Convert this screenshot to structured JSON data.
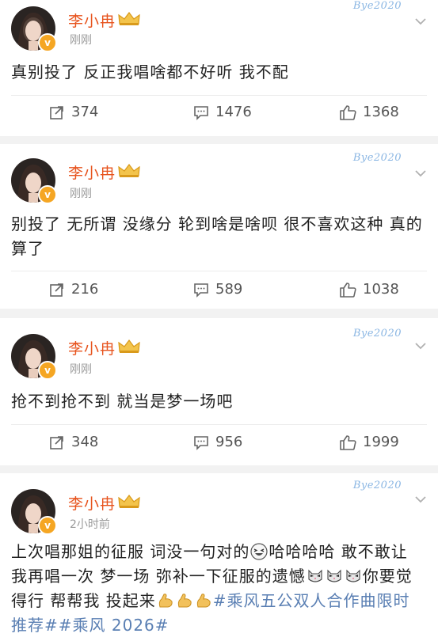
{
  "posts": [
    {
      "username": "李小冉",
      "time": "刚刚",
      "watermark": "Bye2020",
      "text": "真别投了 反正我唱啥都不好听 我不配",
      "reposts": "374",
      "comments": "1476",
      "likes": "1368"
    },
    {
      "username": "李小冉",
      "time": "刚刚",
      "watermark": "Bye2020",
      "text_line1": "别投了 无所谓 没缘分 轮到啥是啥呗 很不喜欢这种 真的",
      "text_line2": "算了",
      "reposts": "216",
      "comments": "589",
      "likes": "1038"
    },
    {
      "username": "李小冉",
      "time": "刚刚",
      "watermark": "Bye2020",
      "text": "抢不到抢不到 就当是梦一场吧",
      "reposts": "348",
      "comments": "956",
      "likes": "1999"
    },
    {
      "username": "李小冉",
      "time": "2小时前",
      "watermark": "Bye2020",
      "line1_a": "上次唱那姐的征服 词没一句对的",
      "line1_b": "哈哈哈哈 敢不敢让",
      "line2_a": "我再唱一次 梦一场 弥补一下征服的遗憾",
      "line2_b": "你要觉",
      "line3_a": "得行 帮帮我 投起来",
      "line3_tag": "#乘风五公双人合作曲限时",
      "line4_tag": "推荐##乘风 2026#"
    }
  ],
  "colors": {
    "username": "#e7531d",
    "hashtag": "#5a7fb3",
    "time": "#9a9a9a",
    "vip_badge": "#f5a623"
  },
  "icons": [
    "repost-icon",
    "comment-icon",
    "like-icon",
    "crown-icon",
    "chevron-down-icon",
    "verified-badge-icon",
    "laughing-emoji",
    "cat-emoji",
    "muscle-emoji"
  ]
}
